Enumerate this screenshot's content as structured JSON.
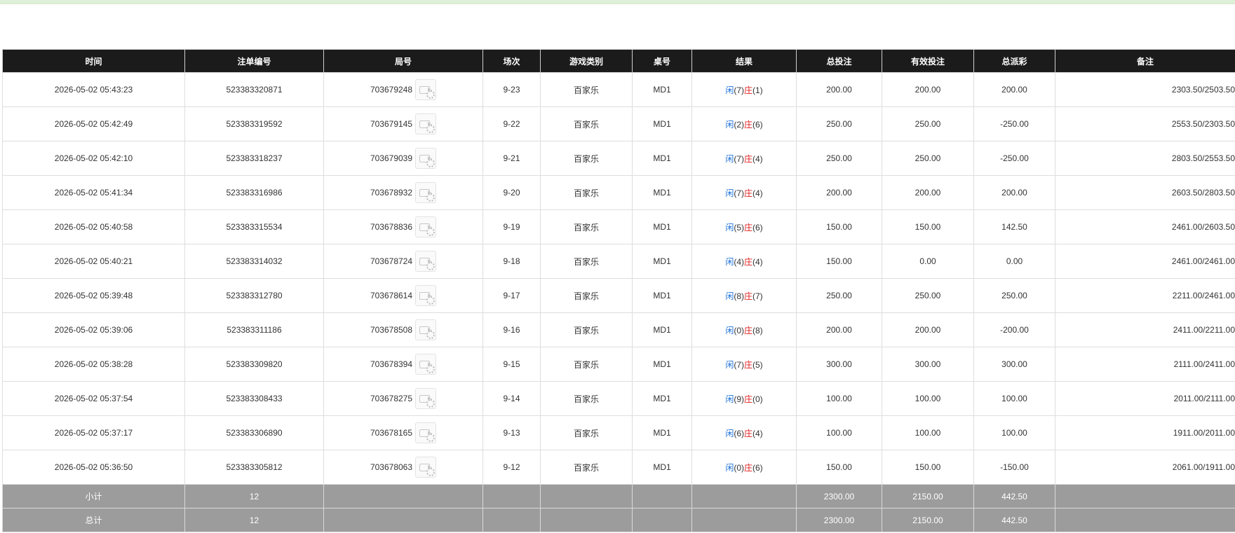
{
  "headers": [
    "时间",
    "注单编号",
    "局号",
    "场次",
    "游戏类别",
    "桌号",
    "结果",
    "总投注",
    "有效投注",
    "总派彩",
    "备注"
  ],
  "rows": [
    {
      "time": "2026-05-02 05:43:23",
      "bet_id": "523383320871",
      "round": "703679248",
      "shoe": "9-23",
      "game": "百家乐",
      "table": "MD1",
      "player_label": "闲",
      "player_points": "(7)",
      "banker_label": "庄",
      "banker_points": "(1)",
      "total_bet": "200.00",
      "valid_bet": "200.00",
      "payout": "200.00",
      "payout_negative": false,
      "remark": "2303.50/2503.50"
    },
    {
      "time": "2026-05-02 05:42:49",
      "bet_id": "523383319592",
      "round": "703679145",
      "shoe": "9-22",
      "game": "百家乐",
      "table": "MD1",
      "player_label": "闲",
      "player_points": "(2)",
      "banker_label": "庄",
      "banker_points": "(6)",
      "total_bet": "250.00",
      "valid_bet": "250.00",
      "payout": "-250.00",
      "payout_negative": true,
      "remark": "2553.50/2303.50"
    },
    {
      "time": "2026-05-02 05:42:10",
      "bet_id": "523383318237",
      "round": "703679039",
      "shoe": "9-21",
      "game": "百家乐",
      "table": "MD1",
      "player_label": "闲",
      "player_points": "(7)",
      "banker_label": "庄",
      "banker_points": "(4)",
      "total_bet": "250.00",
      "valid_bet": "250.00",
      "payout": "-250.00",
      "payout_negative": true,
      "remark": "2803.50/2553.50"
    },
    {
      "time": "2026-05-02 05:41:34",
      "bet_id": "523383316986",
      "round": "703678932",
      "shoe": "9-20",
      "game": "百家乐",
      "table": "MD1",
      "player_label": "闲",
      "player_points": "(7)",
      "banker_label": "庄",
      "banker_points": "(4)",
      "total_bet": "200.00",
      "valid_bet": "200.00",
      "payout": "200.00",
      "payout_negative": false,
      "remark": "2603.50/2803.50"
    },
    {
      "time": "2026-05-02 05:40:58",
      "bet_id": "523383315534",
      "round": "703678836",
      "shoe": "9-19",
      "game": "百家乐",
      "table": "MD1",
      "player_label": "闲",
      "player_points": "(5)",
      "banker_label": "庄",
      "banker_points": "(6)",
      "total_bet": "150.00",
      "valid_bet": "150.00",
      "payout": "142.50",
      "payout_negative": false,
      "remark": "2461.00/2603.50"
    },
    {
      "time": "2026-05-02 05:40:21",
      "bet_id": "523383314032",
      "round": "703678724",
      "shoe": "9-18",
      "game": "百家乐",
      "table": "MD1",
      "player_label": "闲",
      "player_points": "(4)",
      "banker_label": "庄",
      "banker_points": "(4)",
      "total_bet": "150.00",
      "valid_bet": "0.00",
      "payout": "0.00",
      "payout_negative": false,
      "remark": "2461.00/2461.00"
    },
    {
      "time": "2026-05-02 05:39:48",
      "bet_id": "523383312780",
      "round": "703678614",
      "shoe": "9-17",
      "game": "百家乐",
      "table": "MD1",
      "player_label": "闲",
      "player_points": "(8)",
      "banker_label": "庄",
      "banker_points": "(7)",
      "total_bet": "250.00",
      "valid_bet": "250.00",
      "payout": "250.00",
      "payout_negative": false,
      "remark": "2211.00/2461.00"
    },
    {
      "time": "2026-05-02 05:39:06",
      "bet_id": "523383311186",
      "round": "703678508",
      "shoe": "9-16",
      "game": "百家乐",
      "table": "MD1",
      "player_label": "闲",
      "player_points": "(0)",
      "banker_label": "庄",
      "banker_points": "(8)",
      "total_bet": "200.00",
      "valid_bet": "200.00",
      "payout": "-200.00",
      "payout_negative": true,
      "remark": "2411.00/2211.00"
    },
    {
      "time": "2026-05-02 05:38:28",
      "bet_id": "523383309820",
      "round": "703678394",
      "shoe": "9-15",
      "game": "百家乐",
      "table": "MD1",
      "player_label": "闲",
      "player_points": "(7)",
      "banker_label": "庄",
      "banker_points": "(5)",
      "total_bet": "300.00",
      "valid_bet": "300.00",
      "payout": "300.00",
      "payout_negative": false,
      "remark": "2111.00/2411.00"
    },
    {
      "time": "2026-05-02 05:37:54",
      "bet_id": "523383308433",
      "round": "703678275",
      "shoe": "9-14",
      "game": "百家乐",
      "table": "MD1",
      "player_label": "闲",
      "player_points": "(9)",
      "banker_label": "庄",
      "banker_points": "(0)",
      "total_bet": "100.00",
      "valid_bet": "100.00",
      "payout": "100.00",
      "payout_negative": false,
      "remark": "2011.00/2111.00"
    },
    {
      "time": "2026-05-02 05:37:17",
      "bet_id": "523383306890",
      "round": "703678165",
      "shoe": "9-13",
      "game": "百家乐",
      "table": "MD1",
      "player_label": "闲",
      "player_points": "(6)",
      "banker_label": "庄",
      "banker_points": "(4)",
      "total_bet": "100.00",
      "valid_bet": "100.00",
      "payout": "100.00",
      "payout_negative": false,
      "remark": "1911.00/2011.00"
    },
    {
      "time": "2026-05-02 05:36:50",
      "bet_id": "523383305812",
      "round": "703678063",
      "shoe": "9-12",
      "game": "百家乐",
      "table": "MD1",
      "player_label": "闲",
      "player_points": "(0)",
      "banker_label": "庄",
      "banker_points": "(6)",
      "total_bet": "150.00",
      "valid_bet": "150.00",
      "payout": "-150.00",
      "payout_negative": true,
      "remark": "2061.00/1911.00"
    }
  ],
  "subtotal": {
    "label": "小计",
    "count": "12",
    "total_bet": "2300.00",
    "valid_bet": "2150.00",
    "payout": "442.50"
  },
  "total": {
    "label": "总计",
    "count": "12",
    "total_bet": "2300.00",
    "valid_bet": "2150.00",
    "payout": "442.50"
  },
  "colors": {
    "player": "#1a6fd8",
    "banker": "#e01b1b",
    "negative": "#e01b1b",
    "header_bg": "#1b1b1b",
    "summary_bg": "#9c9c9c",
    "top_bar": "#dff0d8"
  },
  "icons": {
    "round_video": "video-replay-icon"
  }
}
